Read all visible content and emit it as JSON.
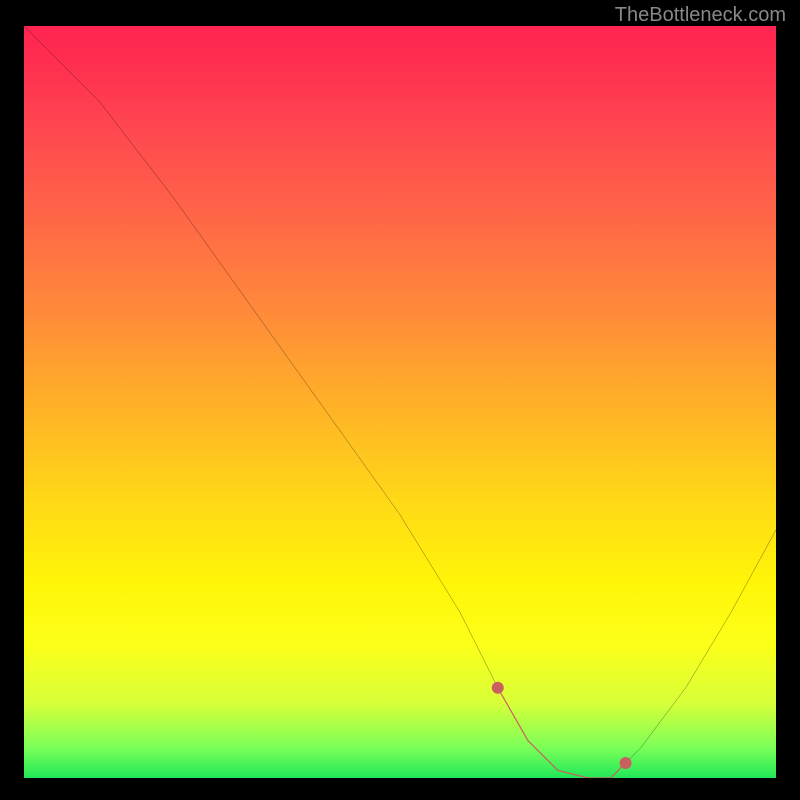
{
  "watermark": "TheBottleneck.com",
  "chart_data": {
    "type": "line",
    "title": "",
    "xlabel": "",
    "ylabel": "",
    "xlim": [
      0,
      100
    ],
    "ylim": [
      0,
      100
    ],
    "grid": false,
    "legend": false,
    "background_gradient": {
      "top": "#ff2450",
      "mid": "#ffd518",
      "bottom": "#20e858"
    },
    "series": [
      {
        "name": "main-curve",
        "color": "#000000",
        "x": [
          0,
          3,
          6,
          10,
          20,
          30,
          40,
          50,
          58,
          63,
          67,
          71,
          75,
          78,
          82,
          88,
          94,
          100
        ],
        "y": [
          100,
          97,
          94,
          90,
          77,
          63,
          49,
          35,
          22,
          12,
          5,
          1,
          0,
          0,
          4,
          12,
          22,
          33
        ]
      },
      {
        "name": "highlight-band",
        "color": "#c96060",
        "x": [
          63,
          67,
          71,
          75,
          78,
          80
        ],
        "y": [
          12,
          5,
          1,
          0,
          0,
          2
        ]
      }
    ],
    "dots": [
      {
        "x": 63,
        "y": 12,
        "color": "#c96060"
      },
      {
        "x": 80,
        "y": 2,
        "color": "#c96060"
      }
    ]
  }
}
